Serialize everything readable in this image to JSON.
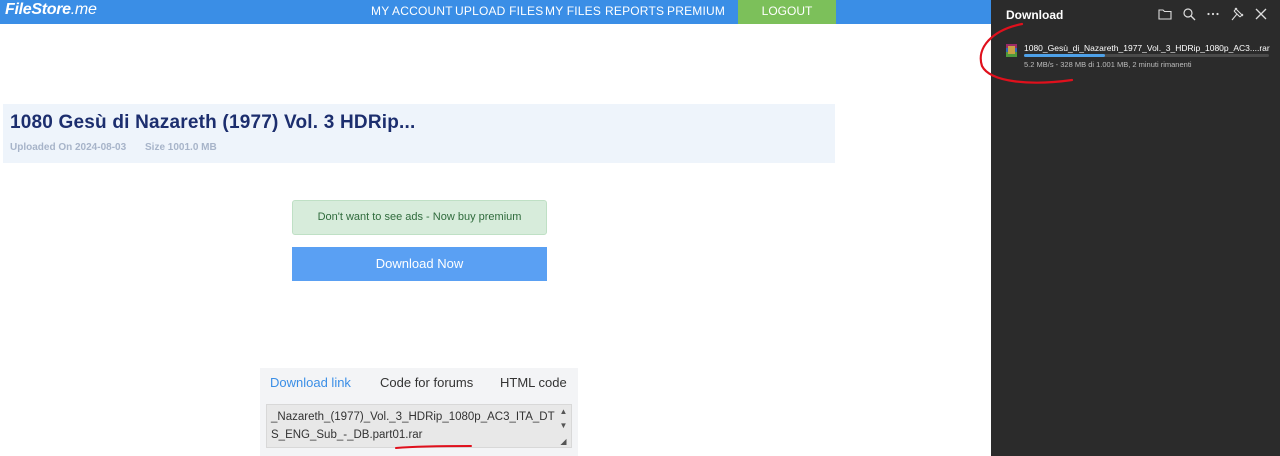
{
  "site": {
    "logo_bold": "FileStore",
    "logo_light": ".me",
    "nav": [
      "MY ACCOUNT",
      "UPLOAD FILES",
      "MY FILES",
      "REPORTS",
      "PREMIUM"
    ],
    "logout_label": "LOGOUT"
  },
  "file": {
    "title": "1080 Gesù di Nazareth (1977) Vol. 3 HDRip...",
    "uploaded": "Uploaded On 2024-08-03",
    "size": "Size 1001.0 MB"
  },
  "premium_text": "Don't want to see ads - Now buy premium",
  "download_now_label": "Download Now",
  "tabs": [
    "Download link",
    "Code for forums",
    "HTML code"
  ],
  "link_text": "_Nazareth_(1977)_Vol._3_HDRip_1080p_AC3_ITA_DTS_ENG_Sub_-_DB.part01.rar",
  "download_panel": {
    "title": "Download",
    "file_name": "1080_Gesù_di_Nazareth_1977_Vol._3_HDRip_1080p_AC3....rar",
    "status": "5.2 MB/s - 328 MB di 1.001 MB, 2 minuti rimanenti",
    "progress": 0.33,
    "icons": [
      "folder-icon",
      "search-icon",
      "more-icon",
      "pin-icon",
      "close-icon"
    ]
  },
  "colors": {
    "nav_bar": "#3a8ee6",
    "logout": "#7cc05a",
    "download_button": "#5aa0f3",
    "panel_bg": "#2b2b2b",
    "annotation_red": "#e0101c"
  }
}
